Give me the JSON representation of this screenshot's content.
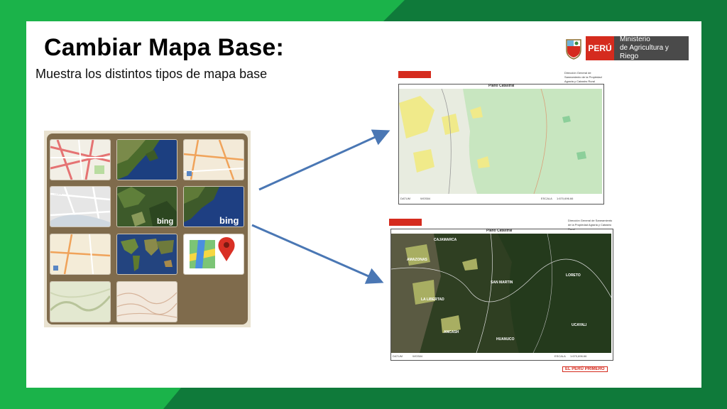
{
  "slide": {
    "title": "Cambiar Mapa Base:",
    "subtitle": "Muestra los distintos tipos de mapa base"
  },
  "logo": {
    "country": "PERÚ",
    "ministry_line1": "Ministerio",
    "ministry_line2": "de Agricultura y Riego"
  },
  "colors": {
    "green_bright": "#1bb34a",
    "green_dark": "#0f7a3a",
    "gallery_brown": "#7f6b4c",
    "arrow_blue": "#4a77b4",
    "peru_red": "#d52b1e"
  },
  "basemaps": [
    {
      "name": "streets",
      "icon": "streets-map-icon"
    },
    {
      "name": "imagery",
      "icon": "satellite-map-icon"
    },
    {
      "name": "topographic",
      "icon": "topo-map-icon"
    },
    {
      "name": "light-gray",
      "icon": "gray-map-icon"
    },
    {
      "name": "bing-aerial",
      "icon": "bing-aerial-map-icon",
      "label": "bing"
    },
    {
      "name": "bing-hybrid",
      "icon": "bing-hybrid-map-icon",
      "label": "bing"
    },
    {
      "name": "national-geographic",
      "icon": "natgeo-map-icon"
    },
    {
      "name": "oceans-world",
      "icon": "world-map-icon"
    },
    {
      "name": "google-maps",
      "icon": "google-maps-icon"
    },
    {
      "name": "terrain",
      "icon": "terrain-map-icon"
    },
    {
      "name": "usgs-topo",
      "icon": "usgs-map-icon"
    }
  ],
  "map_top": {
    "title": "Plano Catastral",
    "header_right": "Dirección General de Saneamiento de la Propiedad Agraria y Catastro Rural",
    "datum_label": "DATUM",
    "datum_value": "WGS84",
    "scale_label": "ESCALA",
    "scale_value": "1:670,696.66"
  },
  "map_bottom": {
    "title": "Plano Catastral",
    "header_right": "Dirección General de Saneamiento de la Propiedad Agraria y Catastro Rural",
    "datum_label": "DATUM",
    "datum_value": "WGS84",
    "scale_label": "ESCALA",
    "scale_value": "1:670,696.66",
    "places": [
      "CAJAMARCA",
      "AMAZONAS",
      "SAN MARTIN",
      "LORETO",
      "LA LIBERTAD",
      "ANCASH",
      "HUANUCO",
      "UCAYALI"
    ],
    "brand": "EL PERÚ PRIMERO"
  }
}
